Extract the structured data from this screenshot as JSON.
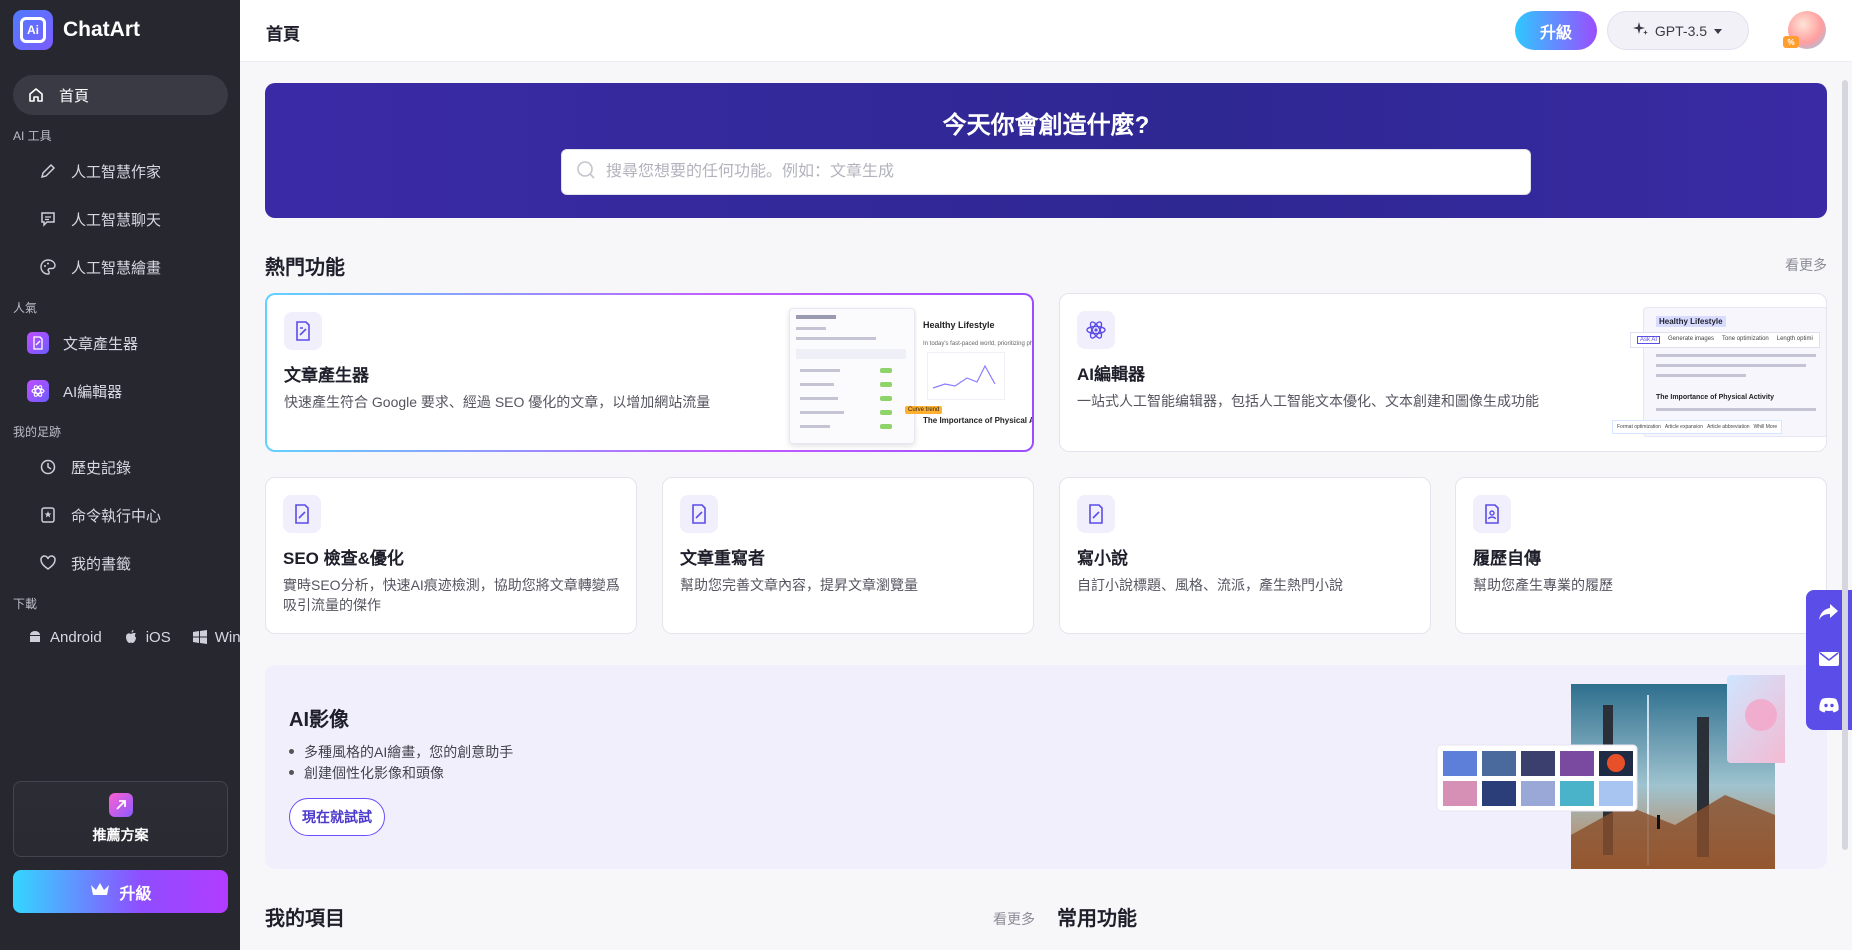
{
  "brand": {
    "name": "ChatArt",
    "logo_text": "Ai"
  },
  "sidebar": {
    "home": "首頁",
    "section_ai_tools": "AI 工具",
    "ai_tools": [
      "人工智慧作家",
      "人工智慧聊天",
      "人工智慧繪畫"
    ],
    "section_popular": "人氣",
    "popular": [
      "文章產生器",
      "AI編輯器"
    ],
    "section_footprint": "我的足跡",
    "footprint": [
      "歷史記錄",
      "命令執行中心",
      "我的書籤"
    ],
    "section_download": "下載",
    "downloads": [
      "Android",
      "iOS",
      "Win"
    ],
    "plan_label": "推薦方案",
    "upgrade_label": "升級"
  },
  "topbar": {
    "title": "首頁",
    "upgrade": "升級",
    "model": "GPT-3.5",
    "avatar_badge": "%"
  },
  "hero": {
    "title": "今天你會創造什麼?",
    "search_placeholder": "搜尋您想要的任何功能。例如：文章生成"
  },
  "hot": {
    "title": "熱門功能",
    "see_more": "看更多",
    "featured": [
      {
        "title": "文章產生器",
        "desc": "快速產生符合 Google 要求、經過 SEO 優化的文章，以增加網站流量",
        "icon": "doc-edit-icon",
        "preview": {
          "heading": "Healthy Lifestyle",
          "body": "In today's fast-paced world, prioritizing phys... ical health and ov",
          "subheading": "The Importance of Physical Activity",
          "badge": "Curve trend"
        }
      },
      {
        "title": "AI編輯器",
        "desc": "一站式人工智能编辑器，包括人工智能文本優化、文本創建和圖像生成功能",
        "icon": "atom-icon",
        "preview": {
          "heading": "Healthy Lifestyle",
          "tabs": [
            "Ask AI",
            "Generate images",
            "Tone optimization",
            "Length optimi"
          ],
          "subheading": "The Importance of Physical Activity",
          "chips": [
            "Format optimization",
            "Article expansion",
            "Article abbreviation",
            "Whill More"
          ]
        }
      }
    ],
    "small": [
      {
        "title": "SEO 檢查&優化",
        "desc": "實時SEO分析，快速AI痕迹檢測，協助您將文章轉變爲吸引流量的傑作",
        "icon": "doc-edit-icon"
      },
      {
        "title": "文章重寫者",
        "desc": "幫助您完善文章內容，提昇文章瀏覽量",
        "icon": "doc-edit-icon"
      },
      {
        "title": "寫小說",
        "desc": "自訂小說標題、風格、流派，產生熱門小說",
        "icon": "doc-edit-icon"
      },
      {
        "title": "履歷自傳",
        "desc": "幫助您產生專業的履歷",
        "icon": "resume-icon"
      }
    ]
  },
  "ai_image": {
    "title": "AI影像",
    "bullets": [
      "多種風格的AI繪畫，您的創意助手",
      "創建個性化影像和頭像"
    ],
    "cta": "現在就試試"
  },
  "projects": {
    "title": "我的項目",
    "see_more": "看更多"
  },
  "common": {
    "title": "常用功能"
  },
  "colors": {
    "accent": "#5b4de8",
    "hero_bg": "#2e2892",
    "sidebar_bg": "#27272f"
  }
}
